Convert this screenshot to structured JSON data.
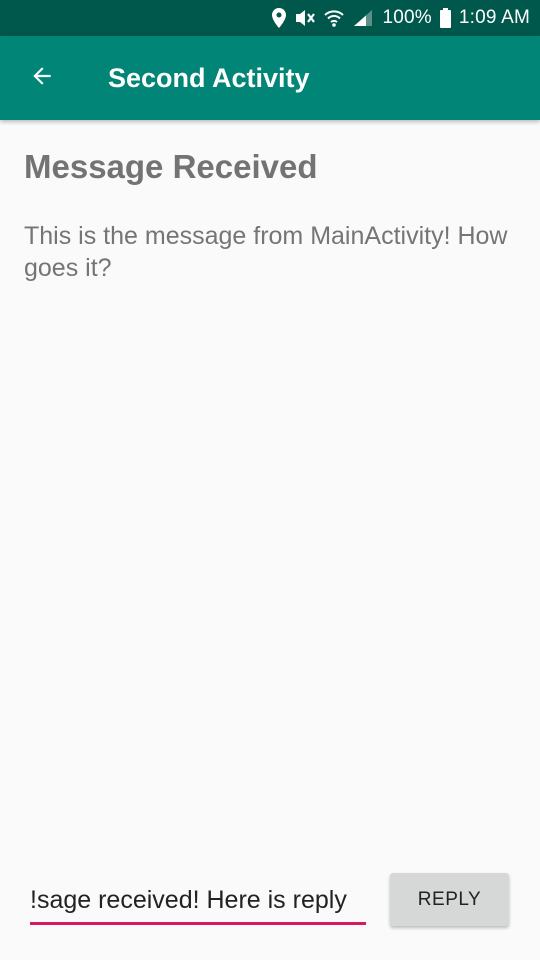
{
  "status_bar": {
    "battery_percent": "100%",
    "time": "1:09 AM",
    "icons": [
      "location-icon",
      "mute-icon",
      "wifi-icon",
      "signal-icon",
      "battery-icon"
    ]
  },
  "app_bar": {
    "title": "Second Activity",
    "back_icon": "arrow-back-icon"
  },
  "content": {
    "heading": "Message Received",
    "message": "This is the message from MainActivity! How goes it?"
  },
  "reply": {
    "input_value": "Message received! Here is reply!",
    "input_visible_text": "sage received! Here is reply!",
    "button_label": "REPLY"
  },
  "colors": {
    "status_bar": "#00574b",
    "primary": "#008577",
    "accent": "#d81b60"
  }
}
